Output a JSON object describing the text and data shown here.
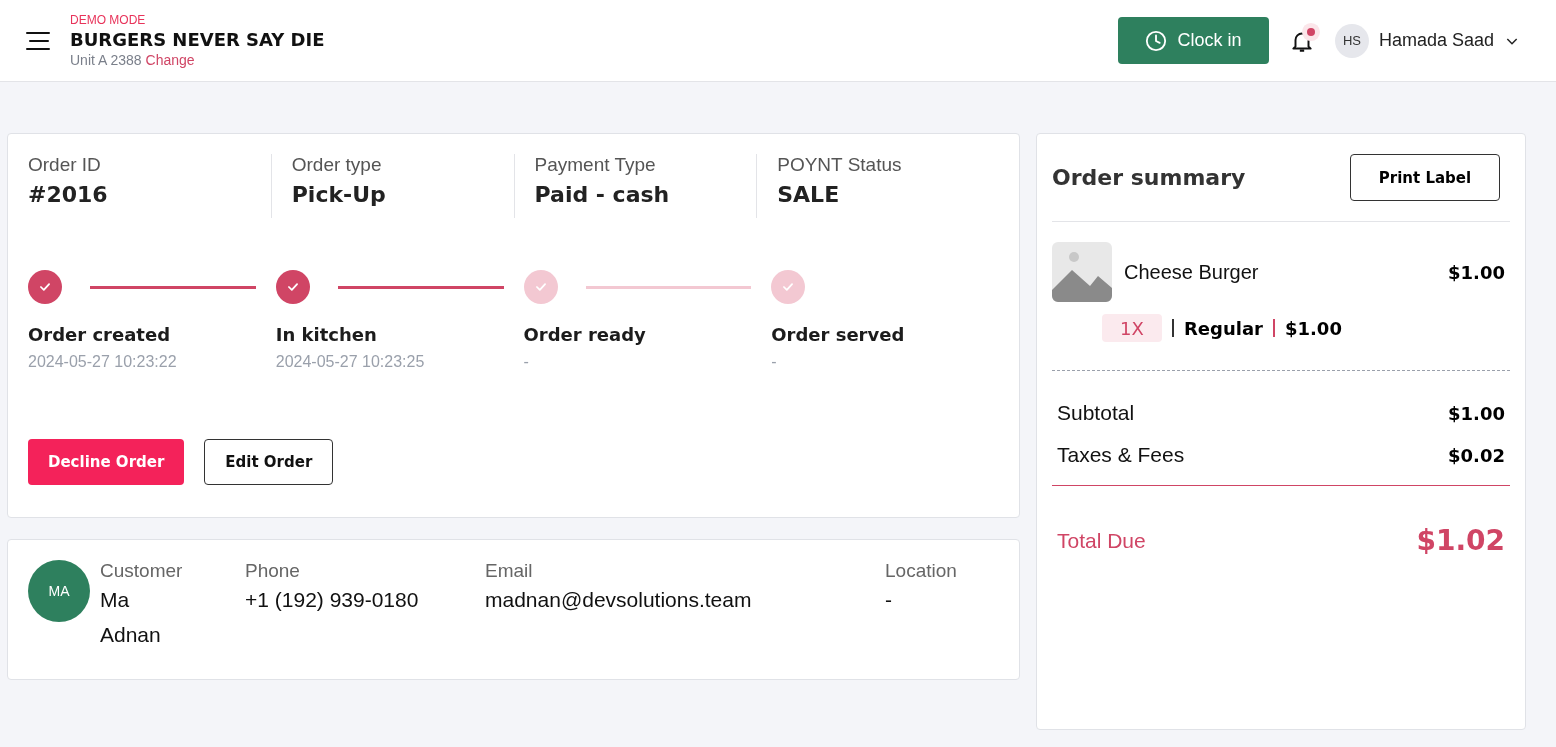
{
  "header": {
    "mode": "DEMO MODE",
    "store": "BURGERS NEVER SAY DIE",
    "unit": "Unit A 2388",
    "change_link": "Change",
    "clock_button": "Clock in",
    "user": {
      "initials": "HS",
      "name": "Hamada Saad"
    }
  },
  "order": {
    "fields": [
      {
        "label": "Order ID",
        "value": "#2016"
      },
      {
        "label": "Order type",
        "value": "Pick-Up"
      },
      {
        "label": "Payment Type",
        "value": "Paid - cash"
      },
      {
        "label": "POYNT Status",
        "value": "SALE"
      }
    ],
    "steps": [
      {
        "title": "Order created",
        "time": "2024-05-27 10:23:22",
        "done": true,
        "line_done": true
      },
      {
        "title": "In kitchen",
        "time": "2024-05-27 10:23:25",
        "done": true,
        "line_done": true
      },
      {
        "title": "Order ready",
        "time": "-",
        "done": false,
        "line_done": false
      },
      {
        "title": "Order served",
        "time": "-",
        "done": false
      }
    ],
    "actions": [
      {
        "label": "Decline Order",
        "kind": "danger"
      },
      {
        "label": "Edit Order",
        "kind": "outline"
      }
    ]
  },
  "customer": {
    "initials": "MA",
    "fields": [
      {
        "label": "Customer",
        "value": "Ma Adnan",
        "kind": "name"
      },
      {
        "label": "Phone",
        "value": "+1 (192) 939-0180",
        "kind": "text"
      },
      {
        "label": "Email",
        "value": "madnan@devsolutions.team",
        "kind": "text"
      },
      {
        "label": "Location",
        "value": "-",
        "kind": "text"
      }
    ]
  },
  "summary": {
    "title": "Order summary",
    "print_button": "Print Label",
    "items": [
      {
        "name": "Cheese Burger",
        "price": "$1.00",
        "qty": "1X",
        "variant": "Regular",
        "variant_price": "$1.00"
      }
    ],
    "lines": [
      {
        "label": "Subtotal",
        "value": "$1.00"
      },
      {
        "label": "Taxes & Fees",
        "value": "$0.02"
      }
    ],
    "total": {
      "label": "Total Due",
      "value": "$1.02"
    }
  }
}
